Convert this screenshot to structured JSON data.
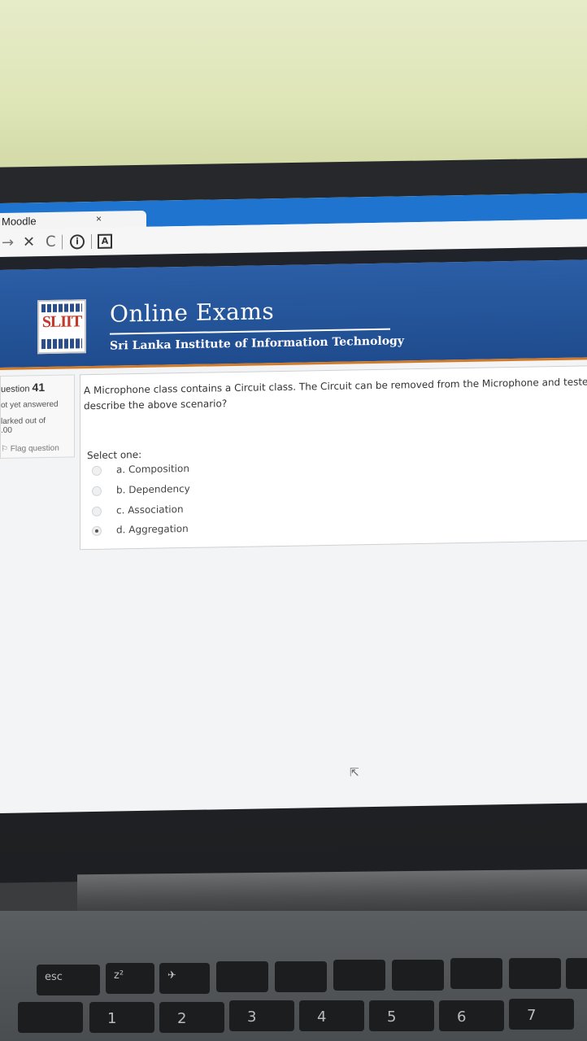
{
  "browser": {
    "tab_title": "Moodle",
    "tab_close": "×",
    "nav_back": "→",
    "nav_stop": "✕",
    "nav_reload": "C",
    "info": "i",
    "doc": "A"
  },
  "site": {
    "logo_text": "SLIIT",
    "title": "Online Exams",
    "subtitle": "Sri Lanka Institute of Information Technology"
  },
  "question": {
    "number_label": "uestion",
    "number": "41",
    "state": "ot yet answered",
    "marks": "larked out of\n.00",
    "flag": "Flag question",
    "text_line1": "A Microphone class contains a Circuit class. The Circuit can be removed from the Microphone and tested o",
    "text_line2": "describe the above scenario?",
    "prompt": "Select one:",
    "options": [
      {
        "label": "a. Composition",
        "selected": false
      },
      {
        "label": "b. Dependency",
        "selected": false
      },
      {
        "label": "c. Association",
        "selected": false
      },
      {
        "label": "d. Aggregation",
        "selected": true
      }
    ]
  },
  "keyboard": {
    "row1": [
      "esc",
      "z²",
      "✈",
      "",
      "",
      "",
      "",
      "",
      "",
      ""
    ],
    "row2": [
      "",
      "1",
      "2",
      "3",
      "4",
      "5",
      "6",
      "7"
    ]
  }
}
